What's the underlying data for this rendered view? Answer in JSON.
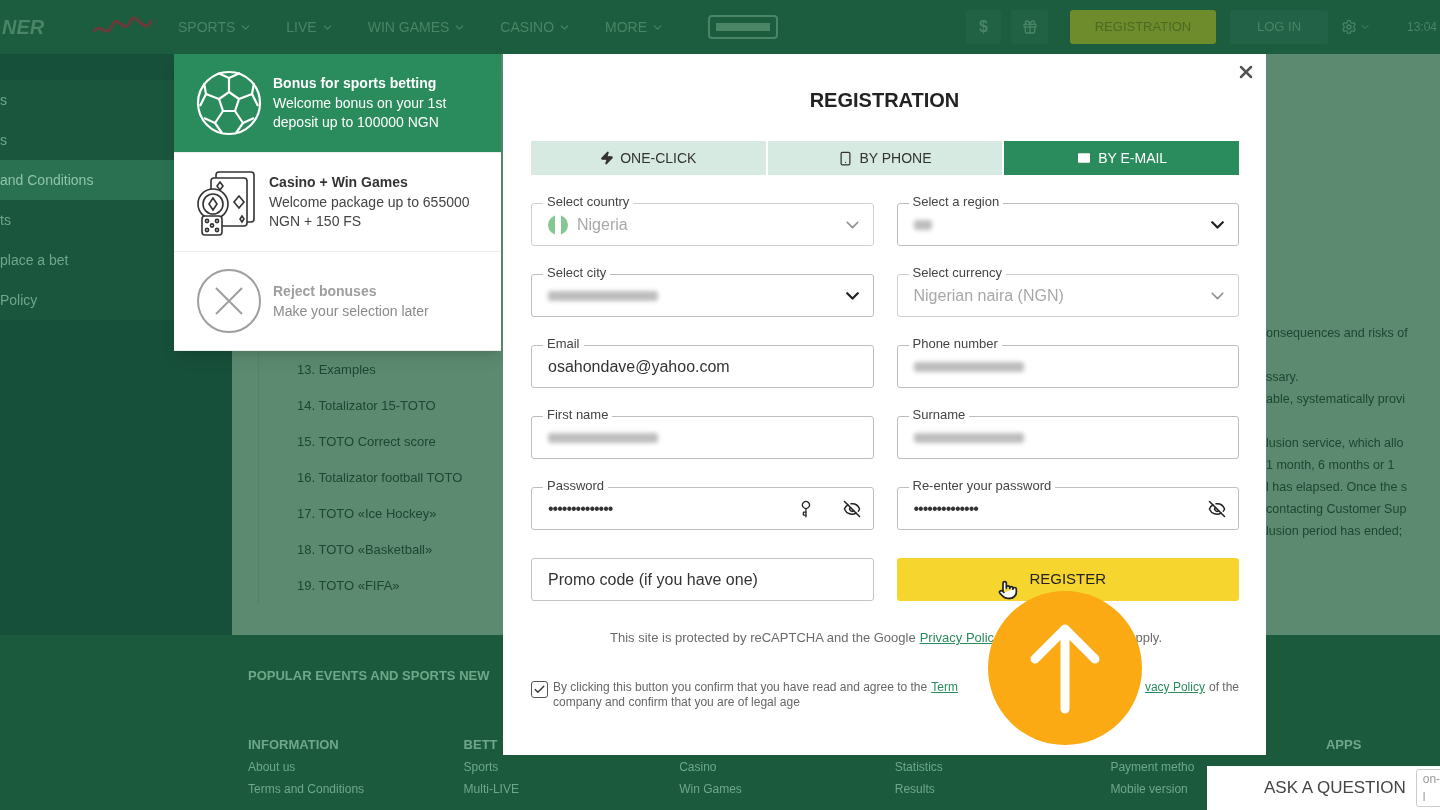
{
  "header": {
    "logo": "NER",
    "nav": [
      {
        "label": "SPORTS"
      },
      {
        "label": "LIVE"
      },
      {
        "label": "WIN GAMES"
      },
      {
        "label": "CASINO"
      },
      {
        "label": "MORE"
      }
    ],
    "currency": "$",
    "registration": "REGISTRATION",
    "login": "LOG IN",
    "time": "13:04"
  },
  "sidebar": {
    "items": [
      {
        "label": "s",
        "selected": false
      },
      {
        "label": "s",
        "selected": false
      },
      {
        "label": "and Conditions",
        "selected": true
      },
      {
        "label": "ts",
        "selected": false
      },
      {
        "label": "place a bet",
        "selected": false
      },
      {
        "label": "Policy",
        "selected": false
      }
    ]
  },
  "content": {
    "list": [
      "13. Examples",
      "14. Totalizator 15-TOTO",
      "15. TOTO Correct score",
      "16. Totalizator football TOTO",
      "17. TOTO «Ice Hockey»",
      "18. TOTO «Basketball»",
      "19. TOTO «FIFA»"
    ],
    "paragraphs": [
      {
        "lines": [
          "onsequences and risks of"
        ]
      },
      {
        "lines": [
          "ssary.",
          "able, systematically provi"
        ]
      },
      {
        "lines": [
          "lusion service, which allo",
          "1 month, 6 months or 1",
          "l has elapsed. Once the s",
          "contacting Customer Sup",
          "lusion period has ended;"
        ]
      }
    ]
  },
  "footer": {
    "popular": "POPULAR EVENTS AND SPORTS NEW",
    "columns": [
      {
        "heading": "INFORMATION",
        "links": [
          "About us",
          "Terms and Conditions"
        ]
      },
      {
        "heading": "BETT",
        "links": [
          "Sports",
          "Multi-LIVE"
        ]
      },
      {
        "links": [
          "Casino",
          "Win Games"
        ]
      },
      {
        "links": [
          "Statistics",
          "Results"
        ]
      },
      {
        "links": [
          "Payment metho",
          "Mobile version"
        ]
      },
      {
        "heading": "APPS"
      }
    ]
  },
  "bonuses": [
    {
      "kind": "sports",
      "title": "Bonus for sports betting",
      "text": "Welcome bonus on your 1st deposit up to 100000 NGN",
      "selected": true
    },
    {
      "kind": "casino",
      "title": "Casino + Win Games",
      "text": "Welcome package up to 655000 NGN + 150 FS",
      "selected": false
    },
    {
      "kind": "reject",
      "title": "Reject bonuses",
      "text": "Make your selection later",
      "selected": false
    }
  ],
  "modal": {
    "title": "REGISTRATION",
    "tabs": [
      {
        "kind": "lightning",
        "label": "ONE-CLICK",
        "selected": false
      },
      {
        "kind": "phone",
        "label": "BY PHONE",
        "selected": false
      },
      {
        "kind": "email",
        "label": "BY E-MAIL",
        "selected": true
      }
    ],
    "fields": [
      {
        "kind": "country",
        "label": "Select country",
        "value": "Nigeria",
        "disabled": true,
        "redacted": false
      },
      {
        "kind": "select",
        "label": "Select a region",
        "disabled": false,
        "redacted": true
      },
      {
        "kind": "select",
        "label": "Select city",
        "disabled": false,
        "redacted": true
      },
      {
        "kind": "select",
        "label": "Select currency",
        "value": "Nigerian naira (NGN)",
        "disabled": true,
        "redacted": false
      },
      {
        "kind": "text",
        "label": "Email",
        "value": "osahondave@yahoo.com",
        "disabled": false,
        "redacted": false
      },
      {
        "kind": "text",
        "label": "Phone number",
        "disabled": false,
        "redacted": true
      },
      {
        "kind": "text",
        "label": "First name",
        "disabled": false,
        "redacted": true
      },
      {
        "kind": "text",
        "label": "Surname",
        "disabled": false,
        "redacted": true
      },
      {
        "kind": "password_key",
        "label": "Password",
        "value": "••••••••••••••",
        "disabled": false,
        "redacted": false
      },
      {
        "kind": "password",
        "label": "Re-enter your password",
        "value": "••••••••••••••",
        "disabled": false,
        "redacted": false
      }
    ],
    "promo": {
      "placeholder": "Promo code (if you have one)"
    },
    "register": "REGISTER",
    "recaptcha": {
      "text": "This site is protected by reCAPTCHA and the Google",
      "link": "Privacy Polic",
      "tail": "pply."
    },
    "consent": {
      "checked": true,
      "text": "By clicking this button you confirm that you have read and agree to the",
      "link_1": "Term",
      "link_2": "vacy Policy",
      "text_2": "of the",
      "text_3": "company and confirm that you are of legal age"
    }
  },
  "ask": {
    "label": "ASK A QUESTION",
    "badge": "on-l"
  }
}
